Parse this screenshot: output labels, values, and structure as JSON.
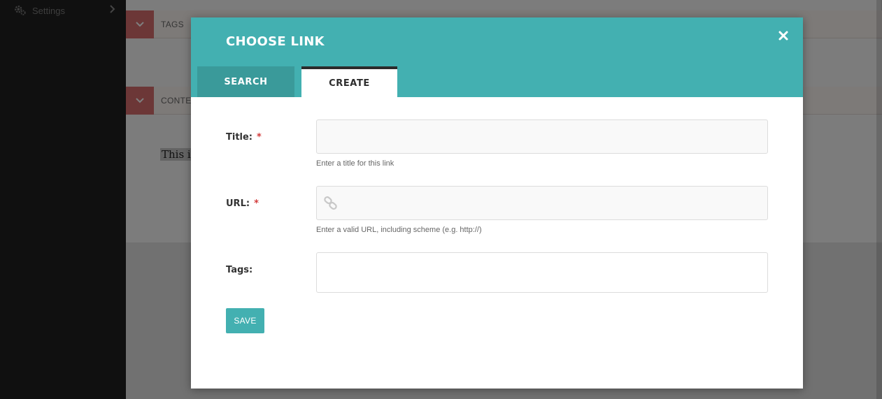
{
  "sidebar": {
    "settings_label": "Settings"
  },
  "page": {
    "tags_section_label": "TAGS",
    "content_section_label": "CONTENT",
    "body_text": "This is"
  },
  "modal": {
    "title": "CHOOSE LINK",
    "tabs": [
      {
        "label": "SEARCH",
        "active": false
      },
      {
        "label": "CREATE",
        "active": true
      }
    ],
    "fields": {
      "title": {
        "label": "Title:",
        "required_mark": "*",
        "value": "",
        "help": "Enter a title for this link"
      },
      "url": {
        "label": "URL:",
        "required_mark": "*",
        "value": "",
        "help": "Enter a valid URL, including scheme (e.g. http://)",
        "icon": "link-icon"
      },
      "tags": {
        "label": "Tags:",
        "value": ""
      }
    },
    "save_label": "SAVE"
  },
  "colors": {
    "accent": "#43b0b1",
    "accent_dark": "#3a9a9a",
    "section_toggle": "#d96f6f",
    "required": "#d23b3b"
  }
}
